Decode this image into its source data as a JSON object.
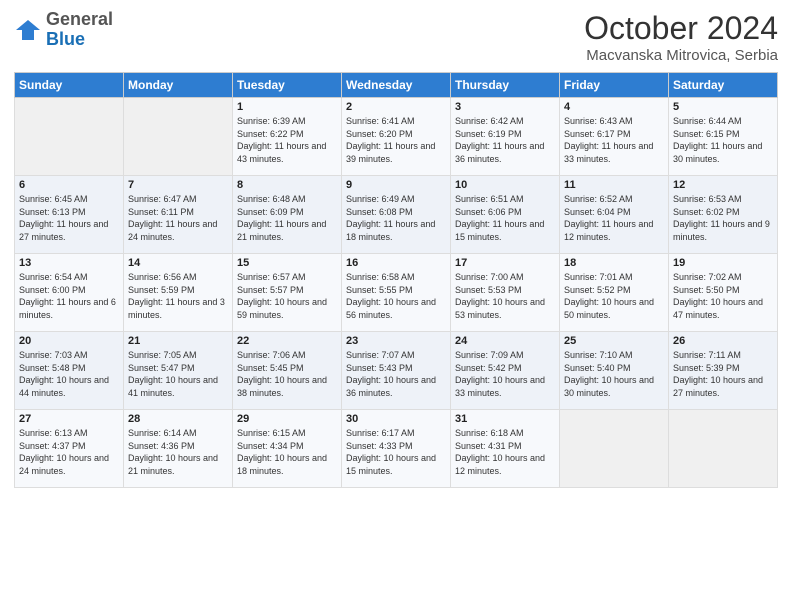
{
  "header": {
    "logo_general": "General",
    "logo_blue": "Blue",
    "month": "October 2024",
    "location": "Macvanska Mitrovica, Serbia"
  },
  "days_of_week": [
    "Sunday",
    "Monday",
    "Tuesday",
    "Wednesday",
    "Thursday",
    "Friday",
    "Saturday"
  ],
  "weeks": [
    [
      {
        "day": "",
        "info": ""
      },
      {
        "day": "",
        "info": ""
      },
      {
        "day": "1",
        "info": "Sunrise: 6:39 AM\nSunset: 6:22 PM\nDaylight: 11 hours and 43 minutes."
      },
      {
        "day": "2",
        "info": "Sunrise: 6:41 AM\nSunset: 6:20 PM\nDaylight: 11 hours and 39 minutes."
      },
      {
        "day": "3",
        "info": "Sunrise: 6:42 AM\nSunset: 6:19 PM\nDaylight: 11 hours and 36 minutes."
      },
      {
        "day": "4",
        "info": "Sunrise: 6:43 AM\nSunset: 6:17 PM\nDaylight: 11 hours and 33 minutes."
      },
      {
        "day": "5",
        "info": "Sunrise: 6:44 AM\nSunset: 6:15 PM\nDaylight: 11 hours and 30 minutes."
      }
    ],
    [
      {
        "day": "6",
        "info": "Sunrise: 6:45 AM\nSunset: 6:13 PM\nDaylight: 11 hours and 27 minutes."
      },
      {
        "day": "7",
        "info": "Sunrise: 6:47 AM\nSunset: 6:11 PM\nDaylight: 11 hours and 24 minutes."
      },
      {
        "day": "8",
        "info": "Sunrise: 6:48 AM\nSunset: 6:09 PM\nDaylight: 11 hours and 21 minutes."
      },
      {
        "day": "9",
        "info": "Sunrise: 6:49 AM\nSunset: 6:08 PM\nDaylight: 11 hours and 18 minutes."
      },
      {
        "day": "10",
        "info": "Sunrise: 6:51 AM\nSunset: 6:06 PM\nDaylight: 11 hours and 15 minutes."
      },
      {
        "day": "11",
        "info": "Sunrise: 6:52 AM\nSunset: 6:04 PM\nDaylight: 11 hours and 12 minutes."
      },
      {
        "day": "12",
        "info": "Sunrise: 6:53 AM\nSunset: 6:02 PM\nDaylight: 11 hours and 9 minutes."
      }
    ],
    [
      {
        "day": "13",
        "info": "Sunrise: 6:54 AM\nSunset: 6:00 PM\nDaylight: 11 hours and 6 minutes."
      },
      {
        "day": "14",
        "info": "Sunrise: 6:56 AM\nSunset: 5:59 PM\nDaylight: 11 hours and 3 minutes."
      },
      {
        "day": "15",
        "info": "Sunrise: 6:57 AM\nSunset: 5:57 PM\nDaylight: 10 hours and 59 minutes."
      },
      {
        "day": "16",
        "info": "Sunrise: 6:58 AM\nSunset: 5:55 PM\nDaylight: 10 hours and 56 minutes."
      },
      {
        "day": "17",
        "info": "Sunrise: 7:00 AM\nSunset: 5:53 PM\nDaylight: 10 hours and 53 minutes."
      },
      {
        "day": "18",
        "info": "Sunrise: 7:01 AM\nSunset: 5:52 PM\nDaylight: 10 hours and 50 minutes."
      },
      {
        "day": "19",
        "info": "Sunrise: 7:02 AM\nSunset: 5:50 PM\nDaylight: 10 hours and 47 minutes."
      }
    ],
    [
      {
        "day": "20",
        "info": "Sunrise: 7:03 AM\nSunset: 5:48 PM\nDaylight: 10 hours and 44 minutes."
      },
      {
        "day": "21",
        "info": "Sunrise: 7:05 AM\nSunset: 5:47 PM\nDaylight: 10 hours and 41 minutes."
      },
      {
        "day": "22",
        "info": "Sunrise: 7:06 AM\nSunset: 5:45 PM\nDaylight: 10 hours and 38 minutes."
      },
      {
        "day": "23",
        "info": "Sunrise: 7:07 AM\nSunset: 5:43 PM\nDaylight: 10 hours and 36 minutes."
      },
      {
        "day": "24",
        "info": "Sunrise: 7:09 AM\nSunset: 5:42 PM\nDaylight: 10 hours and 33 minutes."
      },
      {
        "day": "25",
        "info": "Sunrise: 7:10 AM\nSunset: 5:40 PM\nDaylight: 10 hours and 30 minutes."
      },
      {
        "day": "26",
        "info": "Sunrise: 7:11 AM\nSunset: 5:39 PM\nDaylight: 10 hours and 27 minutes."
      }
    ],
    [
      {
        "day": "27",
        "info": "Sunrise: 6:13 AM\nSunset: 4:37 PM\nDaylight: 10 hours and 24 minutes."
      },
      {
        "day": "28",
        "info": "Sunrise: 6:14 AM\nSunset: 4:36 PM\nDaylight: 10 hours and 21 minutes."
      },
      {
        "day": "29",
        "info": "Sunrise: 6:15 AM\nSunset: 4:34 PM\nDaylight: 10 hours and 18 minutes."
      },
      {
        "day": "30",
        "info": "Sunrise: 6:17 AM\nSunset: 4:33 PM\nDaylight: 10 hours and 15 minutes."
      },
      {
        "day": "31",
        "info": "Sunrise: 6:18 AM\nSunset: 4:31 PM\nDaylight: 10 hours and 12 minutes."
      },
      {
        "day": "",
        "info": ""
      },
      {
        "day": "",
        "info": ""
      }
    ]
  ]
}
